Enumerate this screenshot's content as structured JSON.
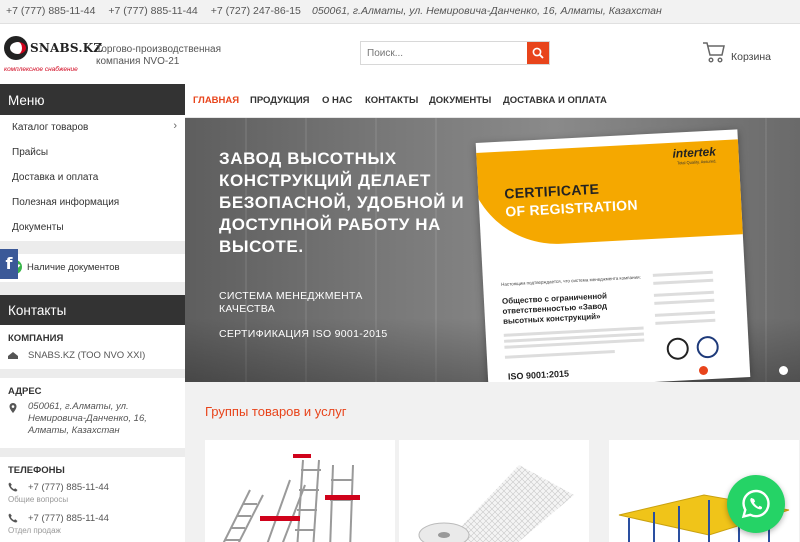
{
  "topbar": {
    "phones": [
      "+7 (777) 885-11-44",
      "+7 (777) 885-11-44",
      "+7 (727) 247-86-15"
    ],
    "address": "050061, г.Алматы, ул. Немировича-Данченко, 16, Алматы, Казахстан"
  },
  "header": {
    "logo_name": "SNABS.KZ",
    "logo_sub": "комплексное снабжение",
    "tagline": "Торгово-производственная компания NVO-21",
    "search_placeholder": "Поиск...",
    "cart_label": "Корзина"
  },
  "nav": [
    {
      "label": "ГЛАВНАЯ",
      "active": true
    },
    {
      "label": "ПРОДУКЦИЯ",
      "active": false
    },
    {
      "label": "О НАС",
      "active": false
    },
    {
      "label": "КОНТАКТЫ",
      "active": false
    },
    {
      "label": "ДОКУМЕНТЫ",
      "active": false
    },
    {
      "label": "ДОСТАВКА И ОПЛАТА",
      "active": false
    }
  ],
  "sidebar": {
    "menu_title": "Меню",
    "items": [
      {
        "label": "Каталог товаров"
      },
      {
        "label": "Прайсы"
      },
      {
        "label": "Доставка и оплата"
      },
      {
        "label": "Полезная информация"
      },
      {
        "label": "Документы"
      }
    ],
    "docs_label": "Наличие документов",
    "contacts_title": "Контакты",
    "company_label": "КОМПАНИЯ",
    "company_name": "SNABS.KZ (ТОО NVO XXI)",
    "address_label": "АДРЕС",
    "address_text": "050061, г.Алматы, ул. Немировича-Данченко, 16, Алматы, Казахстан",
    "phones_label": "ТЕЛЕФОНЫ",
    "phones": [
      {
        "number": "+7 (777) 885-11-44",
        "note": "Общие вопросы"
      },
      {
        "number": "+7 (777) 885-11-44",
        "note": "Отдел продаж"
      }
    ]
  },
  "banner": {
    "title": "ЗАВОД ВЫСОТНЫХ КОНСТРУКЦИЙ ДЕЛАЕТ БЕЗОПАСНОЙ, УДОБНОЙ И ДОСТУПНОЙ РАБОТУ НА ВЫСОТЕ.",
    "subtitle1": "СИСТЕМА МЕНЕДЖМЕНТА КАЧЕСТВА",
    "subtitle2": "СЕРТИФИКАЦИЯ ISO 9001-2015",
    "cert_brand": "intertek",
    "cert_brand_sub": "Total Quality. Assured.",
    "cert_title1": "CERTIFICATE",
    "cert_title2": "OF REGISTRATION",
    "cert_intro": "Настоящим подтверждается, что система менеджмента компании:",
    "cert_org": "Общество с ограниченной ответственностью «Завод высотных конструкций»",
    "cert_standard": "ISO 9001:2015"
  },
  "groups": {
    "title": "Группы товаров и услуг"
  },
  "colors": {
    "accent": "#e8441b",
    "dark": "#333333",
    "whatsapp": "#25d366",
    "facebook": "#3b5998",
    "cert_band": "#f5a800"
  },
  "icons": [
    "search-icon",
    "cart-icon",
    "chevron-right-icon",
    "check-circle-icon",
    "building-icon",
    "map-pin-icon",
    "phone-icon",
    "facebook-icon",
    "whatsapp-icon"
  ]
}
